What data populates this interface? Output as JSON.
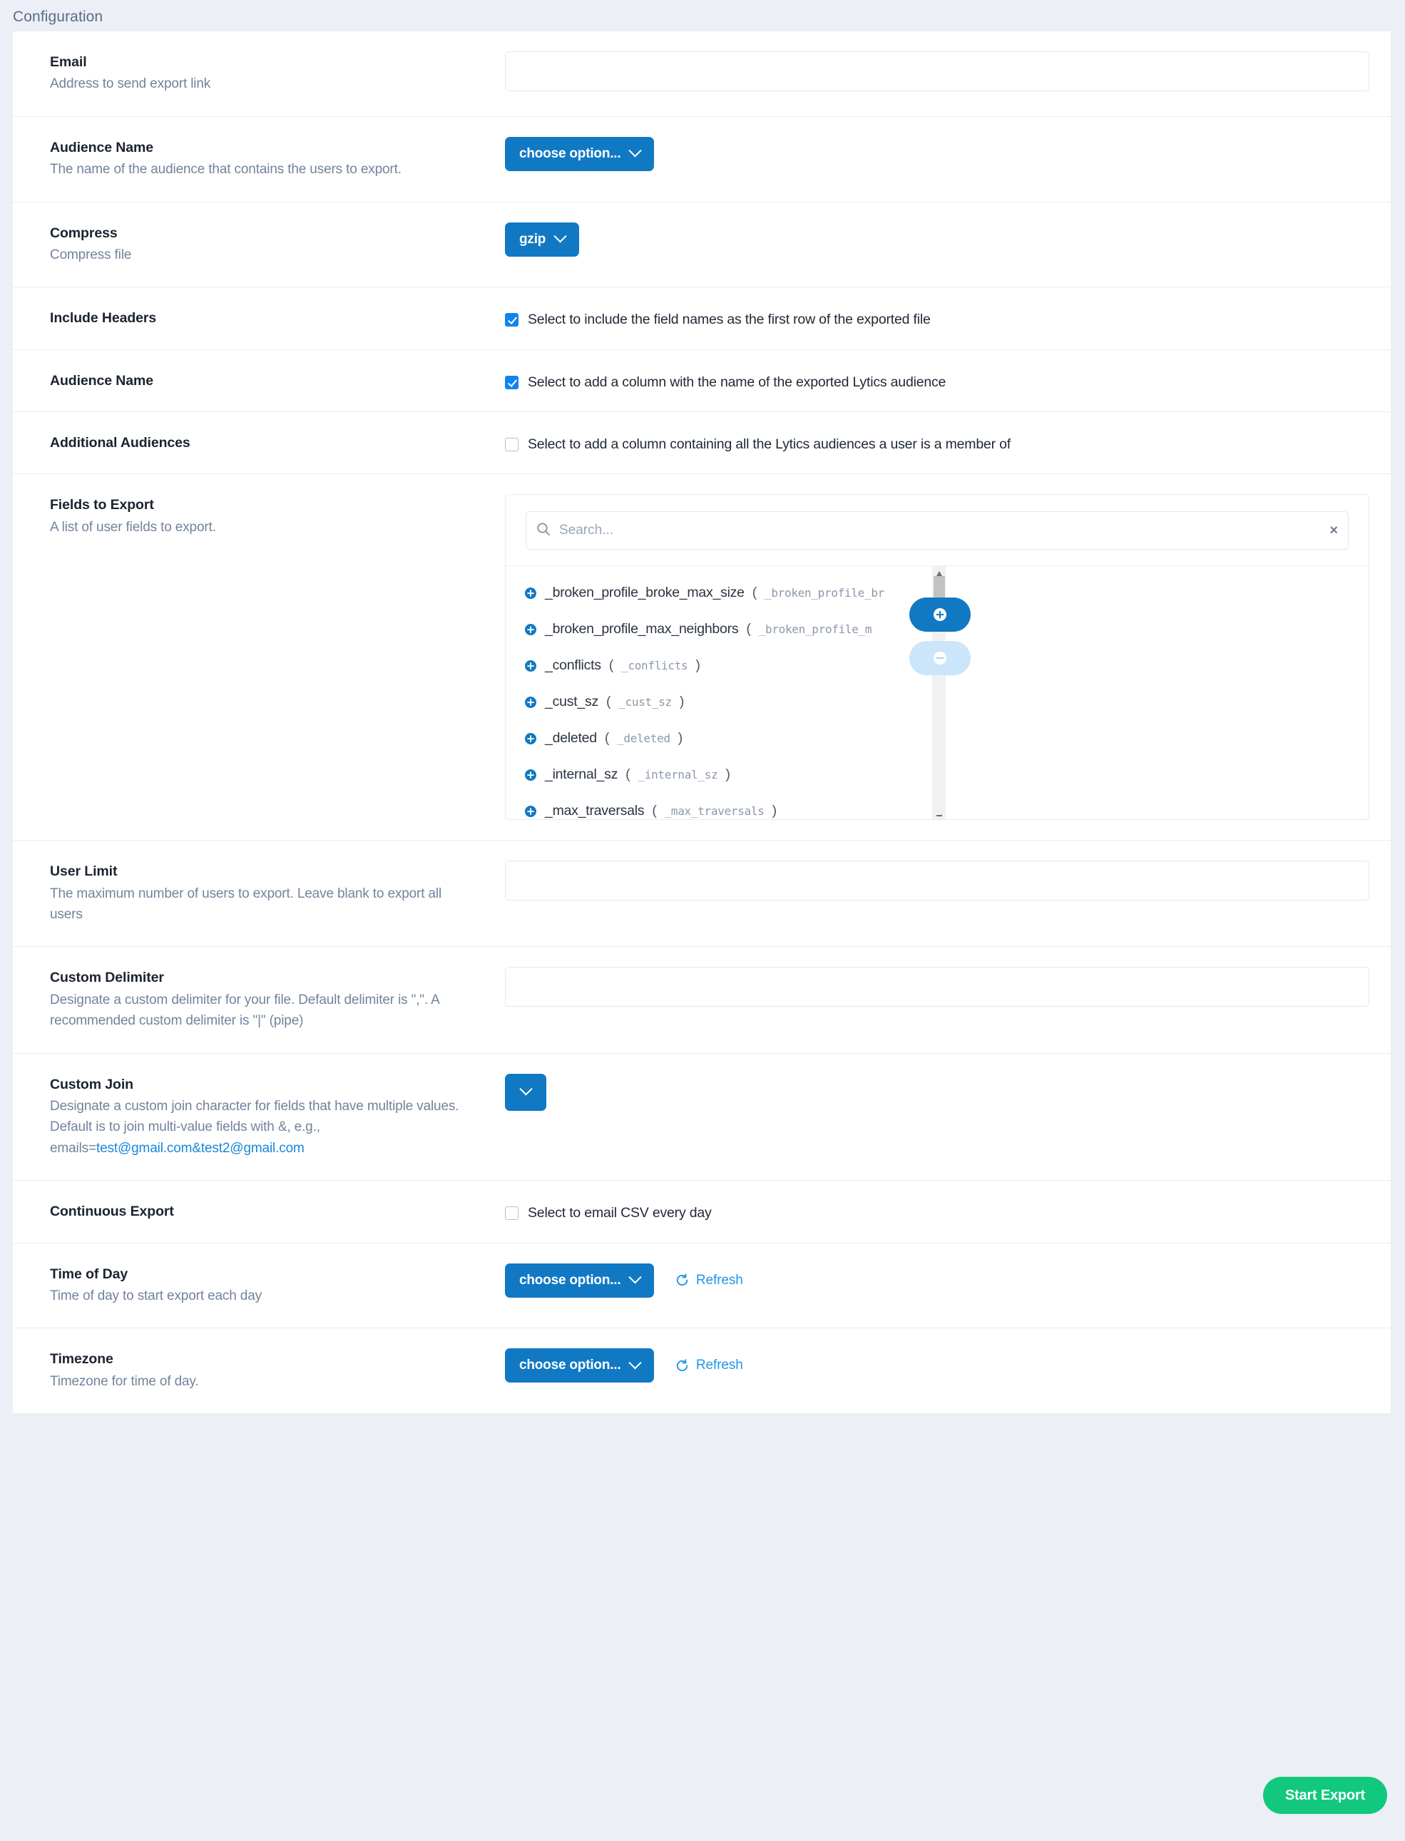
{
  "header": {
    "title": "Configuration"
  },
  "colors": {
    "page_bg": "#eceff5",
    "card_bg": "#ffffff",
    "accent_blue": "#1179c4",
    "link_blue": "#1a87d8",
    "checkbox_blue": "#1184ec",
    "success_green": "#11c87e",
    "label_text": "#1b2330",
    "desc_text": "#73839c"
  },
  "rows": {
    "email": {
      "title": "Email",
      "desc": "Address to send export link",
      "value": "",
      "placeholder": ""
    },
    "audience_name_select": {
      "title": "Audience Name",
      "desc": "The name of the audience that contains the users to export.",
      "button_label": "choose option..."
    },
    "compress": {
      "title": "Compress",
      "desc": "Compress file",
      "button_label": "gzip"
    },
    "include_headers": {
      "title": "Include Headers",
      "checkbox_label": "Select to include the field names as the first row of the exported file",
      "checked": true
    },
    "audience_name_column": {
      "title": "Audience Name",
      "checkbox_label": "Select to add a column with the name of the exported Lytics audience",
      "checked": true
    },
    "additional_audiences": {
      "title": "Additional Audiences",
      "checkbox_label": "Select to add a column containing all the Lytics audiences a user is a member of",
      "checked": false
    },
    "fields_to_export": {
      "title": "Fields to Export",
      "desc": "A list of user fields to export.",
      "search_placeholder": "Search...",
      "search_value": "",
      "clear_label": "×",
      "add_pill_label": "+",
      "remove_pill_label": "−",
      "items": [
        {
          "name": "_broken_profile_broke_max_size",
          "slug": "_broken_profile_br"
        },
        {
          "name": "_broken_profile_max_neighbors",
          "slug": "_broken_profile_m"
        },
        {
          "name": "_conflicts",
          "slug": "_conflicts"
        },
        {
          "name": "_cust_sz",
          "slug": "_cust_sz"
        },
        {
          "name": "_deleted",
          "slug": "_deleted"
        },
        {
          "name": "_internal_sz",
          "slug": "_internal_sz"
        },
        {
          "name": "_max_traversals",
          "slug": "_max_traversals"
        }
      ]
    },
    "user_limit": {
      "title": "User Limit",
      "desc": "The maximum number of users to export. Leave blank to export all users",
      "value": "",
      "placeholder": ""
    },
    "custom_delimiter": {
      "title": "Custom Delimiter",
      "desc": "Designate a custom delimiter for your file. Default delimiter is \",\". A recommended custom delimiter is \"|\" (pipe)",
      "value": "",
      "placeholder": ""
    },
    "custom_join": {
      "title": "Custom Join",
      "desc_prefix": "Designate a custom join character for fields that have multiple values. Default is to join multi-value fields with &, e.g., emails=",
      "desc_link": "test@gmail.com&test2@gmail.com",
      "button_label": ""
    },
    "continuous_export": {
      "title": "Continuous Export",
      "checkbox_label": "Select to email CSV every day",
      "checked": false
    },
    "time_of_day": {
      "title": "Time of Day",
      "desc": "Time of day to start export each day",
      "button_label": "choose option...",
      "refresh_label": "Refresh"
    },
    "timezone": {
      "title": "Timezone",
      "desc": "Timezone for time of day.",
      "button_label": "choose option...",
      "refresh_label": "Refresh"
    }
  },
  "footer": {
    "start_label": "Start Export"
  }
}
